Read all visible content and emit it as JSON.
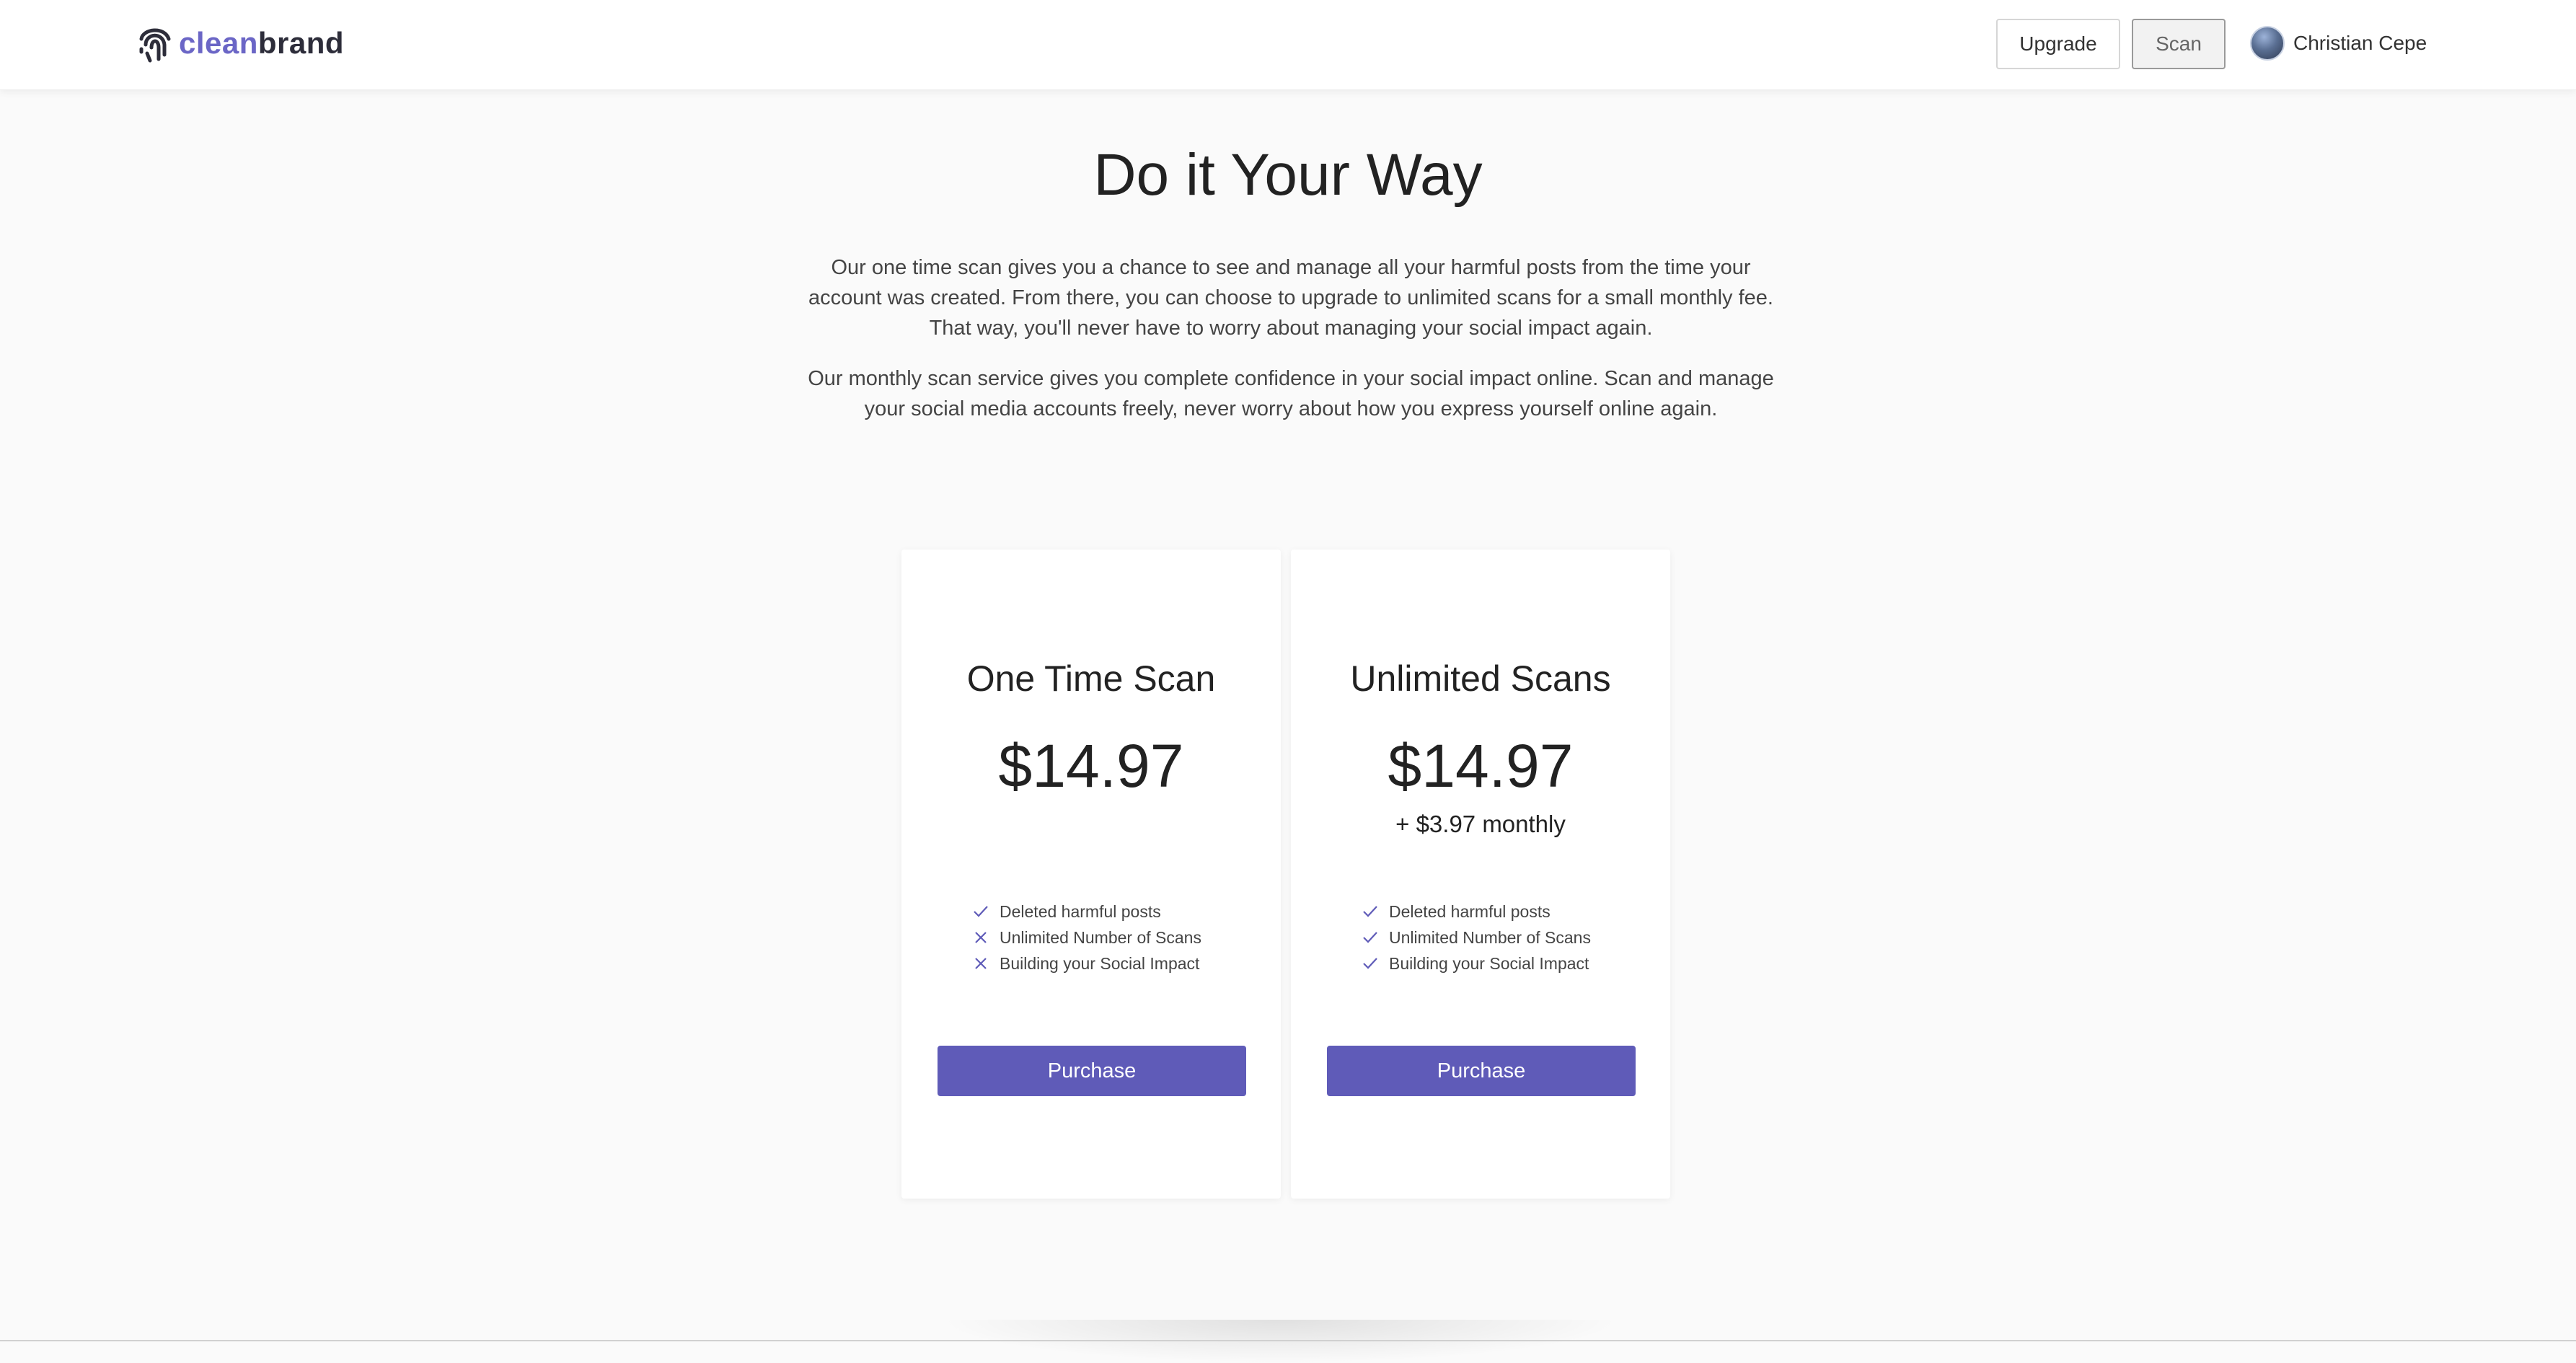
{
  "nav": {
    "logo_clean": "clean",
    "logo_brand": "brand",
    "upgrade_label": "Upgrade",
    "scan_label": "Scan",
    "user_name": "Christian Cepe"
  },
  "page": {
    "title": "Do it Your Way",
    "intro_1": "Our one time scan gives you a chance to see and manage all your harmful posts from the time your account was created. From there, you can choose to upgrade to unlimited scans for a small monthly fee. That way, you'll never have to worry about managing your social impact again.",
    "intro_2": "Our monthly scan service gives you complete confidence in your social impact online. Scan and manage your social media accounts freely, never worry about how you express yourself online again."
  },
  "plans": [
    {
      "title": "One Time Scan",
      "price": "$14.97",
      "subprice": "",
      "features": [
        {
          "label": "Deleted harmful posts",
          "icon": "check-icon"
        },
        {
          "label": "Unlimited Number of Scans",
          "icon": "x-icon"
        },
        {
          "label": "Building your Social Impact",
          "icon": "x-icon"
        }
      ],
      "button": "Purchase"
    },
    {
      "title": "Unlimited Scans",
      "price": "$14.97",
      "subprice": "+ $3.97 monthly",
      "features": [
        {
          "label": "Deleted harmful posts",
          "icon": "check-icon"
        },
        {
          "label": "Unlimited Number of Scans",
          "icon": "check-icon"
        },
        {
          "label": "Building your Social Impact",
          "icon": "check-icon"
        }
      ],
      "button": "Purchase"
    }
  ],
  "colors": {
    "accent": "#5f5bb8",
    "logo_purple": "#6b66c6",
    "logo_dark": "#2d2d3a"
  }
}
